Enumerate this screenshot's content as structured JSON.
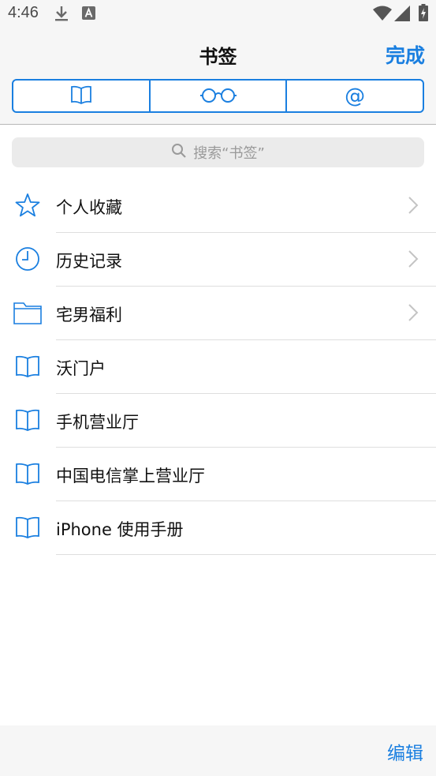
{
  "status_bar": {
    "time": "4:46"
  },
  "nav": {
    "title": "书签",
    "done_label": "完成"
  },
  "segments": [
    {
      "icon": "book-icon"
    },
    {
      "icon": "glasses-icon"
    },
    {
      "label": "@"
    }
  ],
  "search": {
    "placeholder": "搜索“书签”"
  },
  "items": [
    {
      "label": "个人收藏",
      "icon": "star-icon",
      "has_chevron": true
    },
    {
      "label": "历史记录",
      "icon": "clock-icon",
      "has_chevron": true
    },
    {
      "label": "宅男福利",
      "icon": "folder-icon",
      "has_chevron": true
    },
    {
      "label": "沃门户",
      "icon": "book-icon",
      "has_chevron": false
    },
    {
      "label": "手机营业厅",
      "icon": "book-icon",
      "has_chevron": false
    },
    {
      "label": "中国电信掌上营业厅",
      "icon": "book-icon",
      "has_chevron": false
    },
    {
      "label": "iPhone 使用手册",
      "icon": "book-icon",
      "has_chevron": false
    }
  ],
  "toolbar": {
    "edit_label": "编辑"
  },
  "colors": {
    "accent": "#1a7fe0"
  }
}
